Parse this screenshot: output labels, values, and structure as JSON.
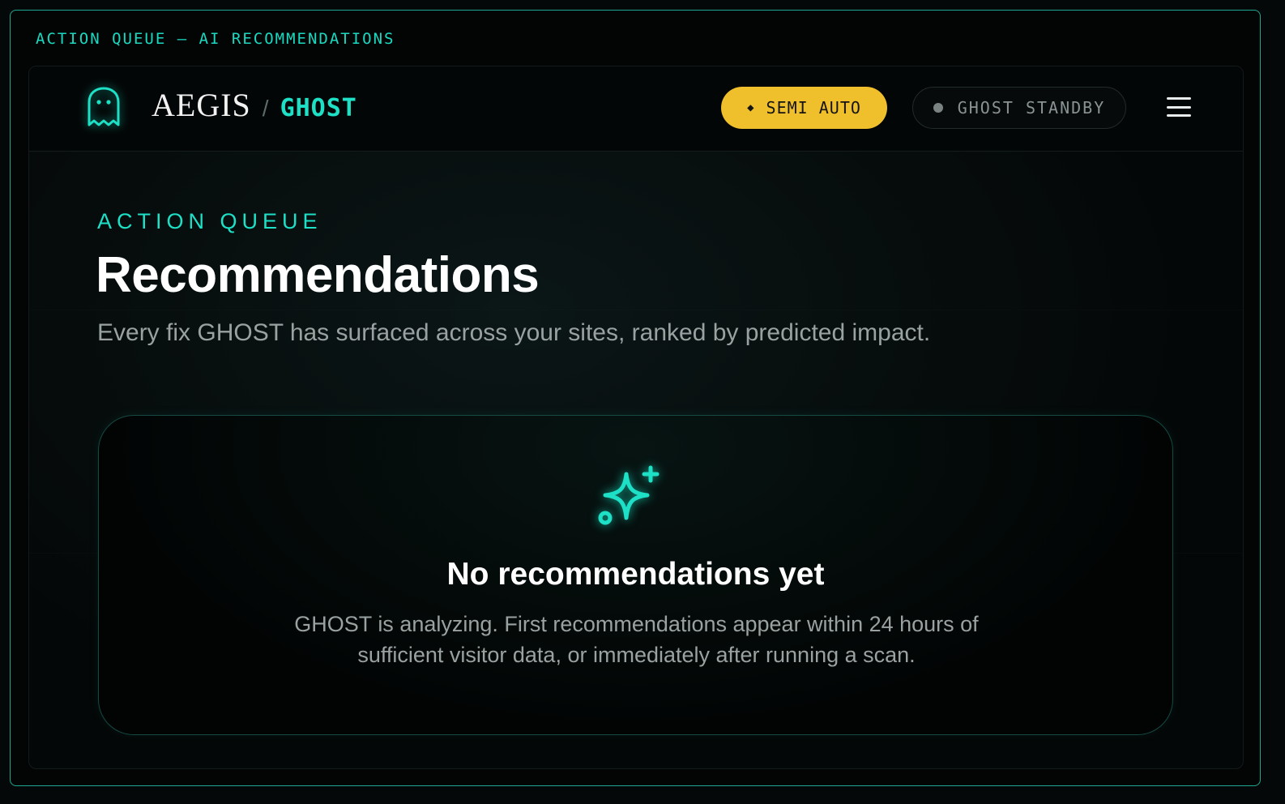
{
  "frame": {
    "title": "ACTION QUEUE – AI RECOMMENDATIONS"
  },
  "header": {
    "brand_name": "AEGIS",
    "brand_separator": "/",
    "product_name": "GHOST",
    "logo_icon": "ghost-icon",
    "mode_pill": {
      "icon": "diamond-icon",
      "label": "SEMI AUTO",
      "color": "#f0bf2c"
    },
    "status_pill": {
      "label": "GHOST STANDBY"
    },
    "menu_icon": "hamburger-menu-icon"
  },
  "main": {
    "eyebrow": "ACTION QUEUE",
    "title": "Recommendations",
    "subtitle": "Every fix GHOST has surfaced across your sites, ranked by predicted impact."
  },
  "empty_state": {
    "icon": "sparkles-icon",
    "title": "No recommendations yet",
    "text": "GHOST is analyzing. First recommendations appear within 24 hours of sufficient visitor data, or immediately after running a scan."
  },
  "colors": {
    "accent": "#1de0c6",
    "frame_border": "#1fa88f",
    "background": "#030505"
  }
}
